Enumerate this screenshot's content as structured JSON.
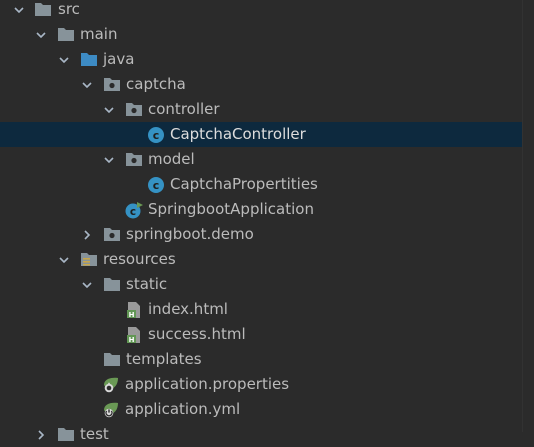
{
  "tree": {
    "items": [
      {
        "label": "src",
        "icon": "folder-icon",
        "expanded": true
      },
      {
        "label": "main",
        "icon": "folder-icon",
        "expanded": true
      },
      {
        "label": "java",
        "icon": "source-root-folder-icon",
        "expanded": true
      },
      {
        "label": "captcha",
        "icon": "package-icon",
        "expanded": true
      },
      {
        "label": "controller",
        "icon": "package-icon",
        "expanded": true
      },
      {
        "label": "CaptchaController",
        "icon": "java-class-icon",
        "selected": true
      },
      {
        "label": "model",
        "icon": "package-icon",
        "expanded": true
      },
      {
        "label": "CaptchaPropertities",
        "icon": "java-class-icon"
      },
      {
        "label": "SpringbootApplication",
        "icon": "spring-boot-class-icon"
      },
      {
        "label": "springboot.demo",
        "icon": "package-icon",
        "expanded": false
      },
      {
        "label": "resources",
        "icon": "resources-folder-icon",
        "expanded": true
      },
      {
        "label": "static",
        "icon": "folder-icon",
        "expanded": true
      },
      {
        "label": "index.html",
        "icon": "html-file-icon"
      },
      {
        "label": "success.html",
        "icon": "html-file-icon"
      },
      {
        "label": "templates",
        "icon": "folder-icon"
      },
      {
        "label": "application.properties",
        "icon": "spring-properties-icon"
      },
      {
        "label": "application.yml",
        "icon": "spring-yml-icon"
      },
      {
        "label": "test",
        "icon": "folder-icon",
        "expanded": false
      }
    ]
  },
  "colors": {
    "background": "#2b2b2b",
    "selection": "#0d293e",
    "text": "#bbbbbb",
    "folder": "#87939a",
    "source_root": "#3d8bc4",
    "class": "#3592c4",
    "spring": "#6a9955",
    "html": "#629755"
  }
}
